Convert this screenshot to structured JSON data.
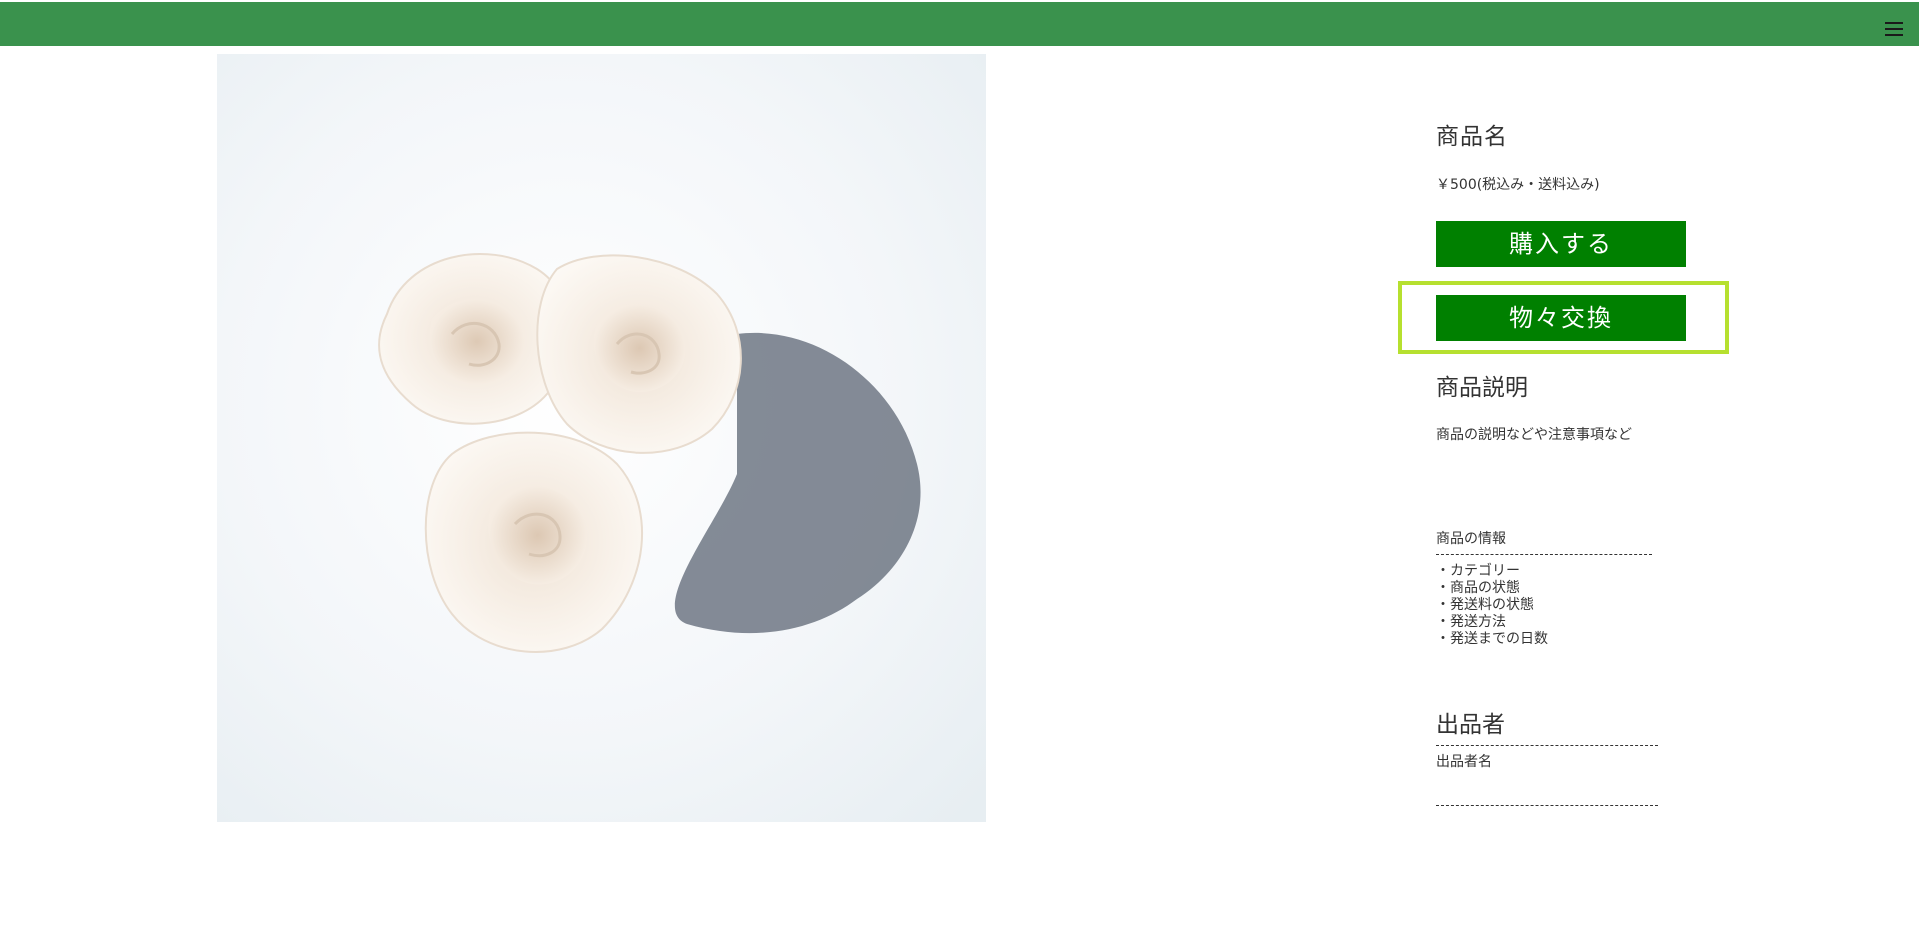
{
  "header": {
    "menu_icon": "hamburger-menu-icon",
    "bar_color": "#3a924d"
  },
  "product": {
    "image": "white-roses-photo",
    "name": "商品名",
    "price": "￥500(税込み・送料込み)",
    "buy_label": "購入する",
    "trade_label": "物々交換",
    "button_color": "#008000",
    "highlight_color": "#b6e02f"
  },
  "description": {
    "title": "商品説明",
    "text": "商品の説明などや注意事項など"
  },
  "details": {
    "title": "商品の情報",
    "items": [
      "・カテゴリー",
      "・商品の状態",
      "・発送料の状態",
      "・発送方法",
      "・発送までの日数"
    ]
  },
  "seller": {
    "title": "出品者",
    "name": "出品者名"
  }
}
